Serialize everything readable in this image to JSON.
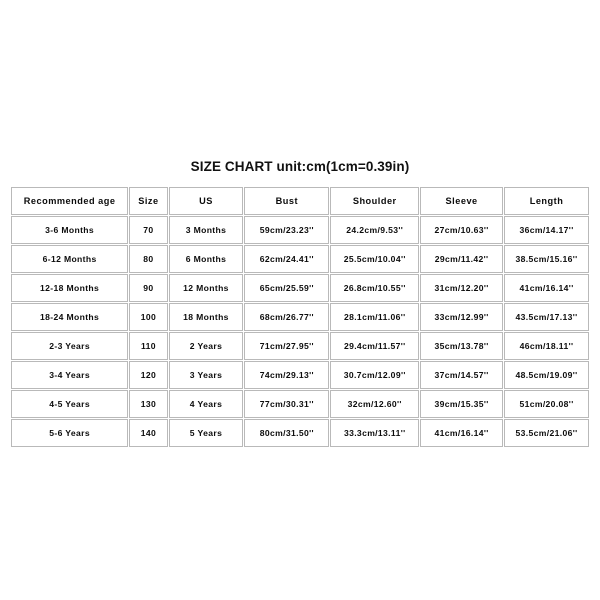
{
  "title": "SIZE CHART unit:cm(1cm=0.39in)",
  "table": {
    "headers": [
      "Recommended age",
      "Size",
      "US",
      "Bust",
      "Shoulder",
      "Sleeve",
      "Length"
    ],
    "rows": [
      {
        "age": "3-6 Months",
        "size": "70",
        "us": "3 Months",
        "bust": "59cm/23.23''",
        "shoulder": "24.2cm/9.53''",
        "sleeve": "27cm/10.63''",
        "length": "36cm/14.17''"
      },
      {
        "age": "6-12 Months",
        "size": "80",
        "us": "6 Months",
        "bust": "62cm/24.41''",
        "shoulder": "25.5cm/10.04''",
        "sleeve": "29cm/11.42''",
        "length": "38.5cm/15.16''"
      },
      {
        "age": "12-18 Months",
        "size": "90",
        "us": "12 Months",
        "bust": "65cm/25.59''",
        "shoulder": "26.8cm/10.55''",
        "sleeve": "31cm/12.20''",
        "length": "41cm/16.14''"
      },
      {
        "age": "18-24 Months",
        "size": "100",
        "us": "18 Months",
        "bust": "68cm/26.77''",
        "shoulder": "28.1cm/11.06''",
        "sleeve": "33cm/12.99''",
        "length": "43.5cm/17.13''"
      },
      {
        "age": "2-3 Years",
        "size": "110",
        "us": "2 Years",
        "bust": "71cm/27.95''",
        "shoulder": "29.4cm/11.57''",
        "sleeve": "35cm/13.78''",
        "length": "46cm/18.11''"
      },
      {
        "age": "3-4 Years",
        "size": "120",
        "us": "3 Years",
        "bust": "74cm/29.13''",
        "shoulder": "30.7cm/12.09''",
        "sleeve": "37cm/14.57''",
        "length": "48.5cm/19.09''"
      },
      {
        "age": "4-5 Years",
        "size": "130",
        "us": "4 Years",
        "bust": "77cm/30.31''",
        "shoulder": "32cm/12.60''",
        "sleeve": "39cm/15.35''",
        "length": "51cm/20.08''"
      },
      {
        "age": "5-6 Years",
        "size": "140",
        "us": "5 Years",
        "bust": "80cm/31.50''",
        "shoulder": "33.3cm/13.11''",
        "sleeve": "41cm/16.14''",
        "length": "53.5cm/21.06''"
      }
    ]
  },
  "colors": {
    "background": "#ffffff",
    "cell_border": "#b9b9b9",
    "text": "#0c0c0c"
  },
  "chart_data": {
    "type": "table",
    "title": "SIZE CHART unit:cm(1cm=0.39in)",
    "columns": [
      "Recommended age",
      "Size",
      "US",
      "Bust",
      "Shoulder",
      "Sleeve",
      "Length"
    ],
    "rows": [
      [
        "3-6 Months",
        "70",
        "3 Months",
        "59cm/23.23''",
        "24.2cm/9.53''",
        "27cm/10.63''",
        "36cm/14.17''"
      ],
      [
        "6-12 Months",
        "80",
        "6 Months",
        "62cm/24.41''",
        "25.5cm/10.04''",
        "29cm/11.42''",
        "38.5cm/15.16''"
      ],
      [
        "12-18 Months",
        "90",
        "12 Months",
        "65cm/25.59''",
        "26.8cm/10.55''",
        "31cm/12.20''",
        "41cm/16.14''"
      ],
      [
        "18-24 Months",
        "100",
        "18 Months",
        "68cm/26.77''",
        "28.1cm/11.06''",
        "33cm/12.99''",
        "43.5cm/17.13''"
      ],
      [
        "2-3 Years",
        "110",
        "2 Years",
        "71cm/27.95''",
        "29.4cm/11.57''",
        "35cm/13.78''",
        "46cm/18.11''"
      ],
      [
        "3-4 Years",
        "120",
        "3 Years",
        "74cm/29.13''",
        "30.7cm/12.09''",
        "37cm/14.57''",
        "48.5cm/19.09''"
      ],
      [
        "4-5 Years",
        "130",
        "4 Years",
        "77cm/30.31''",
        "32cm/12.60''",
        "39cm/15.35''",
        "51cm/20.08''"
      ],
      [
        "5-6 Years",
        "140",
        "5 Years",
        "80cm/31.50''",
        "33.3cm/13.11''",
        "41cm/16.14''",
        "53.5cm/21.06''"
      ]
    ],
    "units": "cm and inches (1cm = 0.39in)"
  }
}
